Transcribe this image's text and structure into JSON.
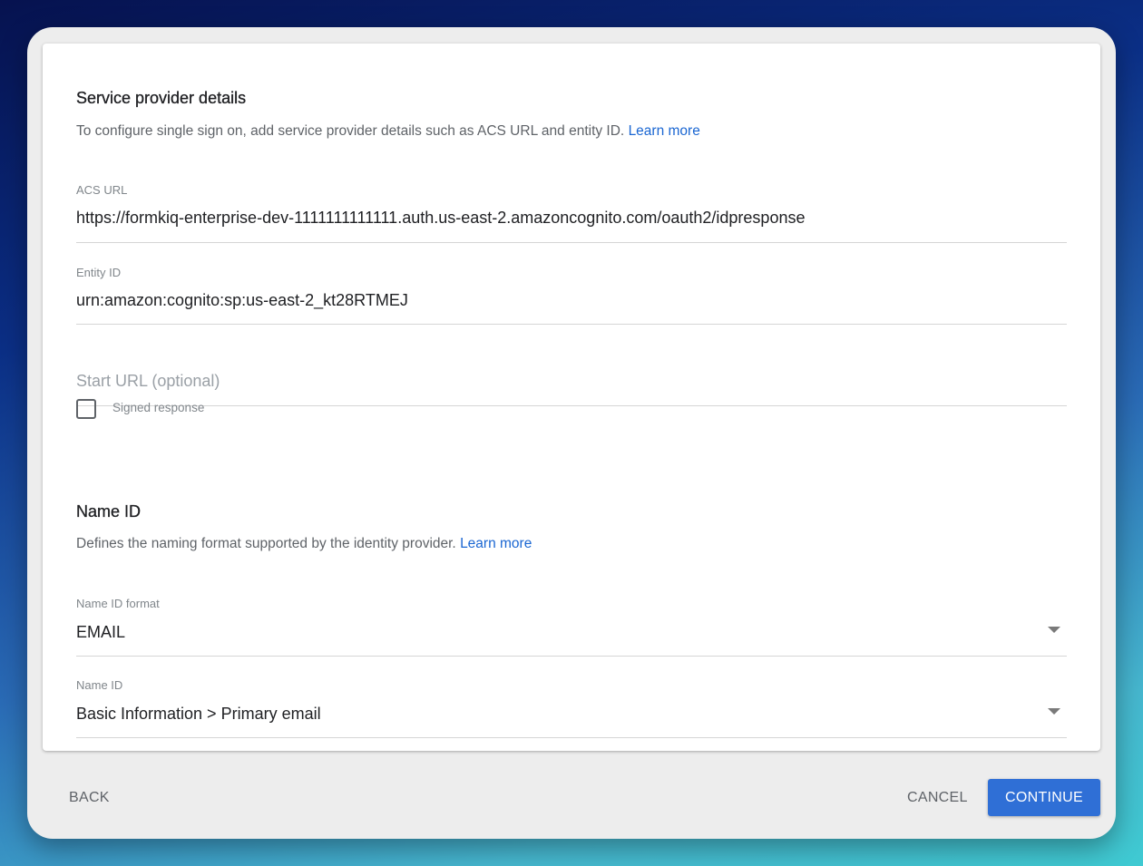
{
  "service_provider": {
    "title": "Service provider details",
    "description": "To configure single sign on, add service provider details such as ACS URL and entity ID.",
    "learn_more": "Learn more",
    "acs_url": {
      "label": "ACS URL",
      "value": "https://formkiq-enterprise-dev-1111111111111.auth.us-east-2.amazoncognito.com/oauth2/idpresponse"
    },
    "entity_id": {
      "label": "Entity ID",
      "value": "urn:amazon:cognito:sp:us-east-2_kt28RTMEJ"
    },
    "start_url": {
      "placeholder": "Start URL (optional)",
      "value": ""
    },
    "signed_response": {
      "label": "Signed response",
      "checked": false
    }
  },
  "name_id_section": {
    "title": "Name ID",
    "description": "Defines the naming format supported by the identity provider.",
    "learn_more": "Learn more",
    "format": {
      "label": "Name ID format",
      "value": "EMAIL",
      "icon": "dropdown-caret"
    },
    "name_id": {
      "label": "Name ID",
      "value": "Basic Information > Primary email",
      "icon": "dropdown-caret"
    }
  },
  "footer": {
    "back": "BACK",
    "cancel": "CANCEL",
    "continue": "CONTINUE",
    "continue_color": "#2f6fd6"
  }
}
